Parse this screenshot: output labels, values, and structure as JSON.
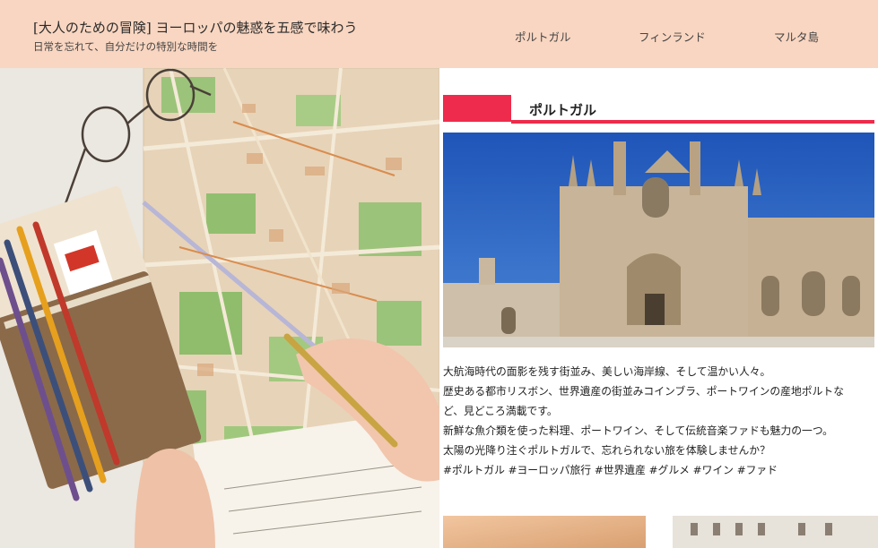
{
  "header": {
    "title": "[大人のための冒険] ヨーロッパの魅惑を五感で味わう",
    "subtitle": "日常を忘れて、自分だけの特別な時間を",
    "nav": [
      "ポルトガル",
      "フィンランド",
      "マルタ島"
    ]
  },
  "section": {
    "heading": "ポルトガル",
    "lines": [
      "大航海時代の面影を残す街並み、美しい海岸線、そして温かい人々。",
      "歴史ある都市リスボン、世界遺産の街並みコインブラ、ポートワインの産地ポルトな",
      "ど、見どころ満載です。",
      "新鮮な魚介類を使った料理、ポートワイン、そして伝統音楽ファドも魅力の一つ。",
      "太陽の光降り注ぐポルトガルで、忘れられない旅を体験しませんか？",
      "#ポルトガル #ヨーロッパ旅行 #世界遺産 #グルメ #ワイン #ファド"
    ]
  },
  "colors": {
    "header_bg": "#f9d6c1",
    "accent": "#ee2b4c",
    "sky": "#2a63c4"
  },
  "icons": [
    "map-hero-photo",
    "monastery-photo"
  ]
}
